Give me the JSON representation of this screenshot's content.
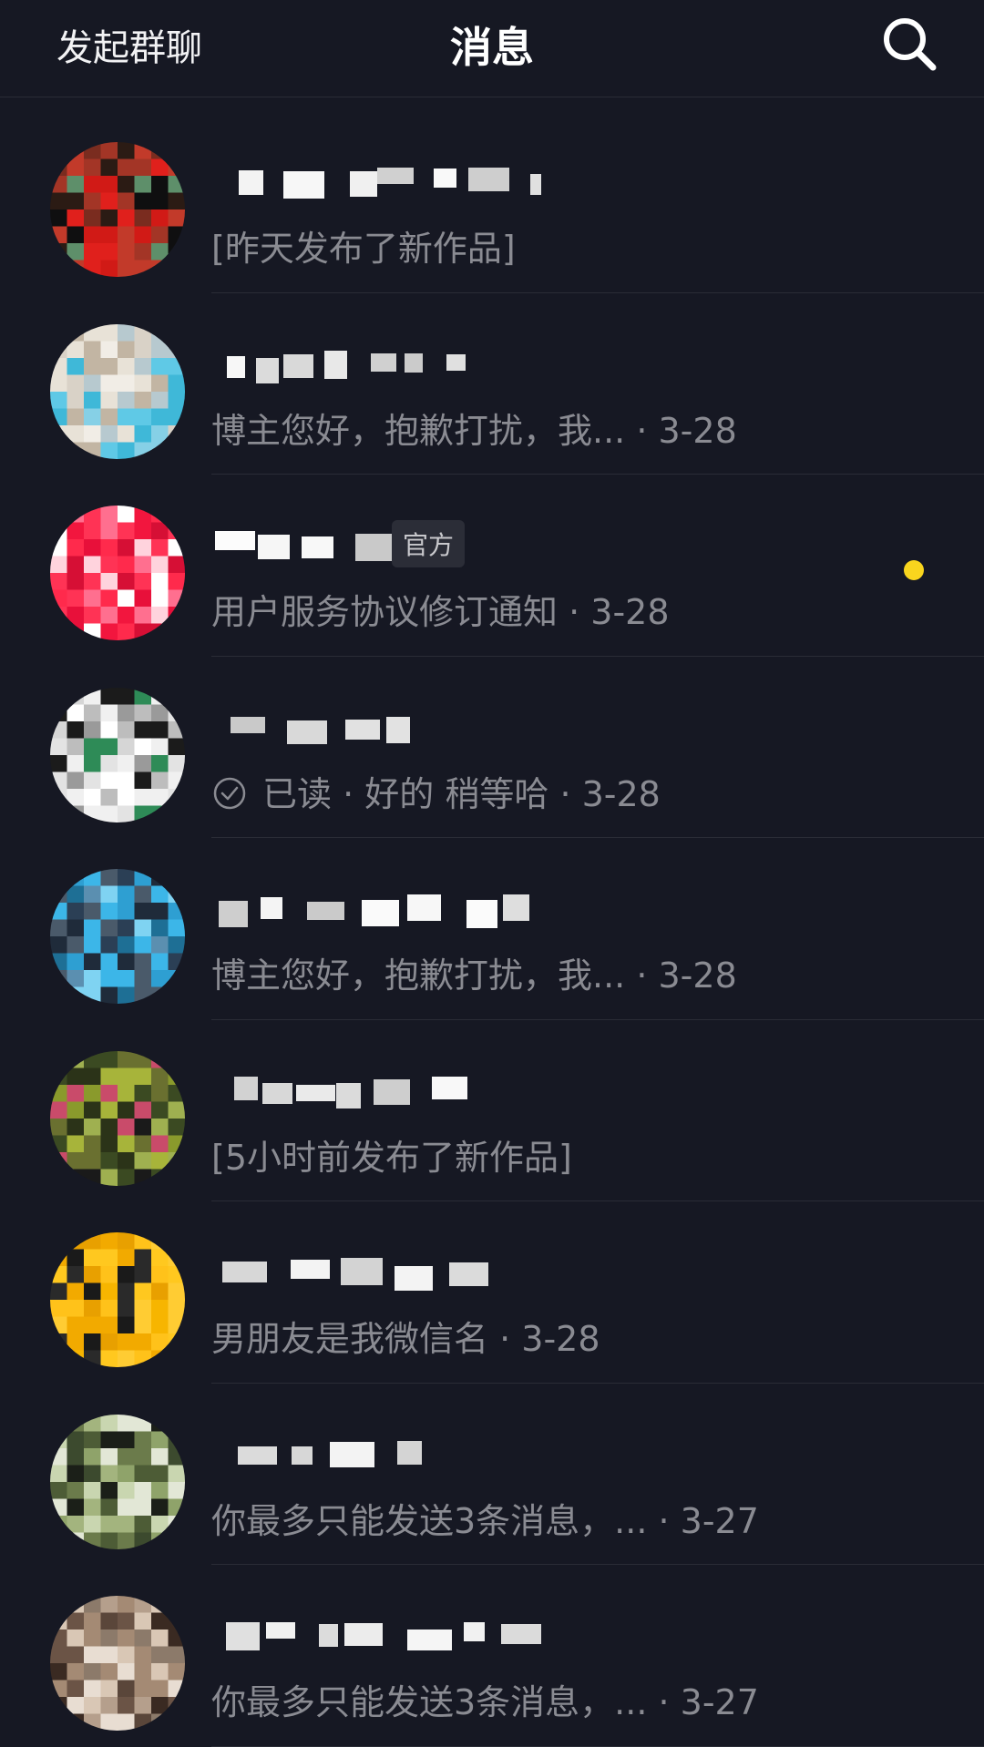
{
  "header": {
    "left_action": "发起群聊",
    "title": "消息",
    "search_icon": "search-icon"
  },
  "colors": {
    "background": "#161823",
    "unread_dot": "#f9d51e",
    "secondary_text": "#8a8b92"
  },
  "conversations": [
    {
      "name_hidden": true,
      "preview": "[昨天发布了新作品]",
      "time": "",
      "official": false,
      "unread": false,
      "read_receipt": false
    },
    {
      "name_hidden": true,
      "preview": "博主您好，抱歉打扰，我...",
      "time": "3-28",
      "official": false,
      "unread": false,
      "read_receipt": false
    },
    {
      "name_hidden": true,
      "badge": "官方",
      "preview": "用户服务协议修订通知",
      "time": "3-28",
      "official": true,
      "unread": true,
      "read_receipt": false
    },
    {
      "name_hidden": true,
      "read_label": "已读",
      "preview": "好的 稍等哈",
      "time": "3-28",
      "official": false,
      "unread": false,
      "read_receipt": true
    },
    {
      "name_hidden": true,
      "preview": "博主您好，抱歉打扰，我...",
      "time": "3-28",
      "official": false,
      "unread": false,
      "read_receipt": false
    },
    {
      "name_hidden": true,
      "preview": "[5小时前发布了新作品]",
      "time": "",
      "official": false,
      "unread": false,
      "read_receipt": false
    },
    {
      "name_hidden": true,
      "preview": "男朋友是我微信名",
      "time": "3-28",
      "official": false,
      "unread": false,
      "read_receipt": false
    },
    {
      "name_hidden": true,
      "preview": "你最多只能发送3条消息，...",
      "time": "3-27",
      "official": false,
      "unread": false,
      "read_receipt": false
    },
    {
      "name_hidden": true,
      "preview": "你最多只能发送3条消息，...",
      "time": "3-27",
      "official": false,
      "unread": false,
      "read_receipt": false
    }
  ]
}
